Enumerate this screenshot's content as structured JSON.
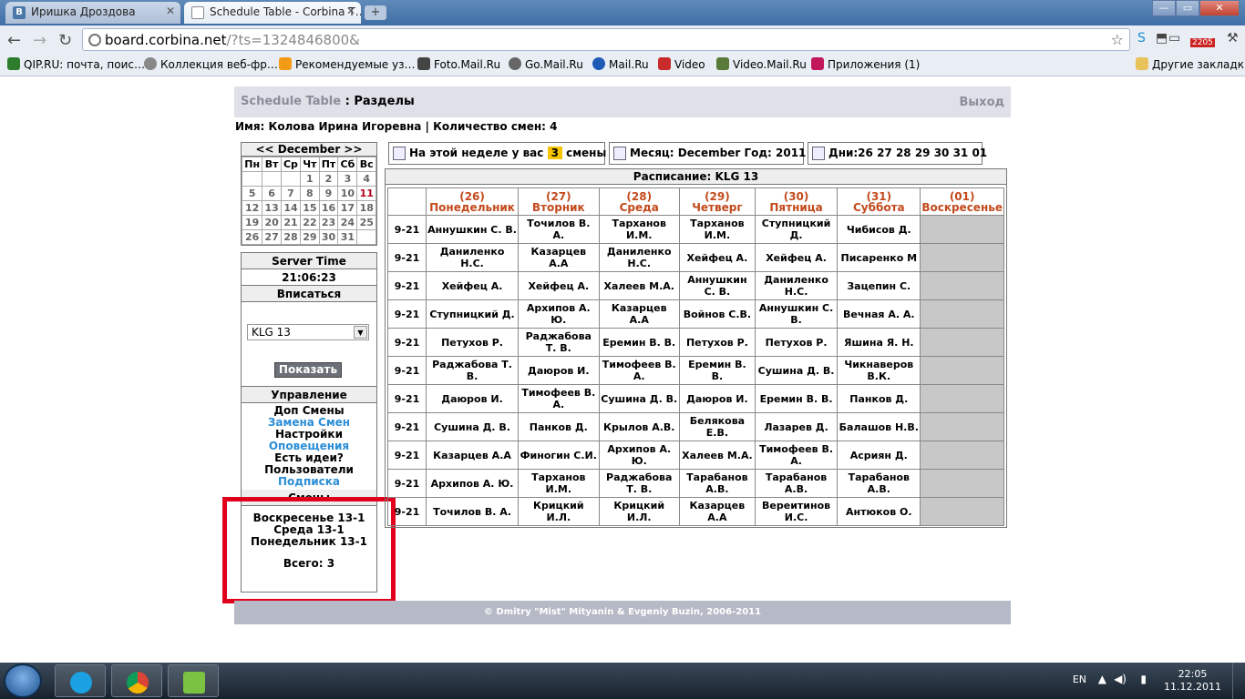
{
  "browser": {
    "tabs": [
      {
        "label": "Иришка Дроздова",
        "icon": "vk-icon"
      },
      {
        "label": "Schedule Table - Corbina T…",
        "icon": "page-icon"
      }
    ],
    "tab_close": "✕",
    "new_tab": "+",
    "window_buttons": {
      "minimize": "—",
      "maximize": "▭",
      "close": "✕"
    },
    "address": {
      "host": "board.corbina.net",
      "rest": "/?ts=1324846800&"
    },
    "badge_count": "2205",
    "bookmarks": [
      {
        "label": "QIP.RU: почта, поис…",
        "color": "#2d7d2d"
      },
      {
        "label": "Коллекция веб-фр…",
        "color": "#888888"
      },
      {
        "label": "Рекомендуемые уз…",
        "color": "#f39b16"
      },
      {
        "label": "Foto.Mail.Ru",
        "color": "#444444"
      },
      {
        "label": "Go.Mail.Ru",
        "color": "#666666"
      },
      {
        "label": "Mail.Ru",
        "color": "#1e5bb5"
      },
      {
        "label": "Video",
        "color": "#c92a2a"
      },
      {
        "label": "Video.Mail.Ru",
        "color": "#5a7a3a"
      },
      {
        "label": "Приложения (1)",
        "color": "#c2185b"
      }
    ],
    "other_bookmarks": "Другие закладки"
  },
  "header": {
    "brand": "Schedule Table",
    "separator": " : ",
    "section": "Разделы",
    "logout": "Выход"
  },
  "user_info": "Имя: Колова Ирина Игоревна | Количество смен: 4",
  "calendar": {
    "title": "<< December >>",
    "weekdays": [
      "Пн",
      "Вт",
      "Ср",
      "Чт",
      "Пт",
      "Сб",
      "Вс"
    ],
    "weeks": [
      [
        "",
        "",
        "",
        "1",
        "2",
        "3",
        "4"
      ],
      [
        "5",
        "6",
        "7",
        "8",
        "9",
        "10",
        "11"
      ],
      [
        "12",
        "13",
        "14",
        "15",
        "16",
        "17",
        "18"
      ],
      [
        "19",
        "20",
        "21",
        "22",
        "23",
        "24",
        "25"
      ],
      [
        "26",
        "27",
        "28",
        "29",
        "30",
        "31",
        ""
      ]
    ],
    "today": "11",
    "today_color": "#b3001b"
  },
  "server_time": {
    "label": "Server Time",
    "value": "21:06:23"
  },
  "signup": {
    "label": "Вписаться",
    "selected": "KLG 13",
    "show_button": "Показать"
  },
  "management": {
    "label": "Управление",
    "items": [
      {
        "label": "Доп Смены",
        "link": false
      },
      {
        "label": "Замена Смен",
        "link": true
      },
      {
        "label": "Настройки",
        "link": false
      },
      {
        "label": "Оповещения",
        "link": true
      },
      {
        "label": "Есть идеи?",
        "link": false
      },
      {
        "label": "Пользователи",
        "link": false
      },
      {
        "label": "Подписка",
        "link": true
      }
    ],
    "link_color": "#2b8ed6"
  },
  "shifts": {
    "label": "Смены",
    "items": [
      "Воскресенье 13-1",
      "Среда 13-1",
      "Понедельник 13-1"
    ],
    "total": "Всего: 3"
  },
  "info_bar": {
    "week_prefix": "На этой неделе у вас",
    "week_count": "3",
    "week_suffix": "смены",
    "month": "Месяц: December Год: 2011",
    "days": "Дни:26 27 28 29 30 31 01"
  },
  "schedule": {
    "title": "Расписание: KLG 13",
    "days": [
      {
        "num": "(26)",
        "name": "Понедельник"
      },
      {
        "num": "(27)",
        "name": "Вторник"
      },
      {
        "num": "(28)",
        "name": "Среда"
      },
      {
        "num": "(29)",
        "name": "Четверг"
      },
      {
        "num": "(30)",
        "name": "Пятница"
      },
      {
        "num": "(31)",
        "name": "Суббота"
      },
      {
        "num": "(01)",
        "name": "Воскресенье"
      }
    ],
    "header_color": "#c24a1c",
    "rows": [
      {
        "time": "9-21",
        "cells": [
          "Аннушкин С. В.",
          "Точилов В. А.",
          "Тарханов И.М.",
          "Тарханов И.М.",
          "Ступницкий Д.",
          "Чибисов Д.",
          ""
        ]
      },
      {
        "time": "9-21",
        "cells": [
          "Даниленко Н.С.",
          "Казарцев А.А",
          "Даниленко Н.С.",
          "Хейфец А.",
          "Хейфец А.",
          "Писаренко М",
          ""
        ]
      },
      {
        "time": "9-21",
        "cells": [
          "Хейфец А.",
          "Хейфец А.",
          "Халеев М.А.",
          "Аннушкин С. В.",
          "Даниленко Н.С.",
          "Зацепин С.",
          ""
        ]
      },
      {
        "time": "9-21",
        "cells": [
          "Ступницкий Д.",
          "Архипов А. Ю.",
          "Казарцев А.А",
          "Войнов С.В.",
          "Аннушкин С. В.",
          "Вечная А. А.",
          ""
        ]
      },
      {
        "time": "9-21",
        "cells": [
          "Петухов Р.",
          "Раджабова Т. В.",
          "Еремин В. В.",
          "Петухов Р.",
          "Петухов Р.",
          "Яшина Я. Н.",
          ""
        ]
      },
      {
        "time": "9-21",
        "cells": [
          "Раджабова Т. В.",
          "Даюров И.",
          "Тимофеев В. А.",
          "Еремин В. В.",
          "Сушина Д. В.",
          "Чикнаверов В.К.",
          ""
        ]
      },
      {
        "time": "9-21",
        "cells": [
          "Даюров И.",
          "Тимофеев В. А.",
          "Сушина Д. В.",
          "Даюров И.",
          "Еремин В. В.",
          "Панков Д.",
          ""
        ]
      },
      {
        "time": "9-21",
        "cells": [
          "Сушина Д. В.",
          "Панков Д.",
          "Крылов А.В.",
          "Белякова Е.В.",
          "Лазарев Д.",
          "Балашов Н.В.",
          ""
        ]
      },
      {
        "time": "9-21",
        "cells": [
          "Казарцев А.А",
          "Финогин С.И.",
          "Архипов А. Ю.",
          "Халеев М.А.",
          "Тимофеев В. А.",
          "Асриян Д.",
          ""
        ]
      },
      {
        "time": "9-21",
        "cells": [
          "Архипов А. Ю.",
          "Тарханов И.М.",
          "Раджабова Т. В.",
          "Тарабанов А.В.",
          "Тарабанов А.В.",
          "Тарабанов А.В.",
          ""
        ]
      },
      {
        "time": "9-21",
        "cells": [
          "Точилов В. А.",
          "Крицкий И.Л.",
          "Крицкий И.Л.",
          "Казарцев А.А",
          "Вереитинов И.С.",
          "Антюков О.",
          ""
        ]
      }
    ]
  },
  "footer": "© Dmitry \"Mist\" Mityanin & Evgeniy Buzin, 2006-2011",
  "highlight_color": "#e0001b",
  "taskbar": {
    "apps": [
      "skype-icon",
      "chrome-icon",
      "app-icon"
    ],
    "lang": "EN",
    "time": "22:05",
    "date": "11.12.2011"
  }
}
